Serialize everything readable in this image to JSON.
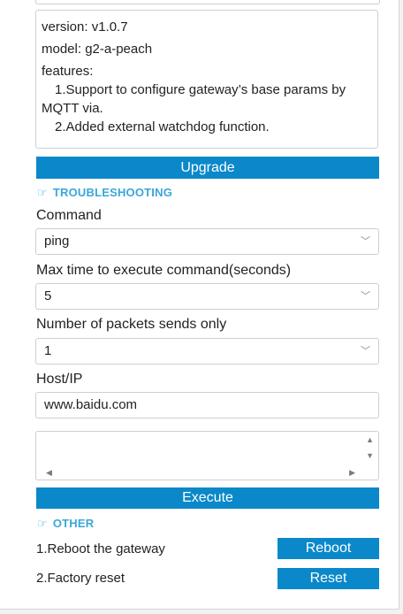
{
  "release_notes": {
    "version": "version: v1.0.7",
    "model": "model: g2-a-peach",
    "features_heading": "features:",
    "feature_1a": "1.Support to configure gateway’s base params by",
    "feature_1b": "MQTT via.",
    "feature_2": "2.Added external watchdog function."
  },
  "upgrade_button": "Upgrade",
  "troubleshooting": {
    "title": "TROUBLESHOOTING",
    "command_label": "Command",
    "command_value": "ping",
    "max_time_label": "Max time to execute command(seconds)",
    "max_time_value": "5",
    "packets_label": "Number of packets sends only",
    "packets_value": "1",
    "host_label": "Host/IP",
    "host_value": "www.baidu.com",
    "output_value": "",
    "execute_button": "Execute"
  },
  "other": {
    "title": "OTHER",
    "reboot_label": "1.Reboot the gateway",
    "reboot_button": "Reboot",
    "reset_label": "2.Factory reset",
    "reset_button": "Reset"
  },
  "colors": {
    "accent": "#0a88c9",
    "section_title": "#3aa7d9"
  },
  "icons": {
    "section": "pointing-hand-icon",
    "select": "chevron-down-icon"
  }
}
